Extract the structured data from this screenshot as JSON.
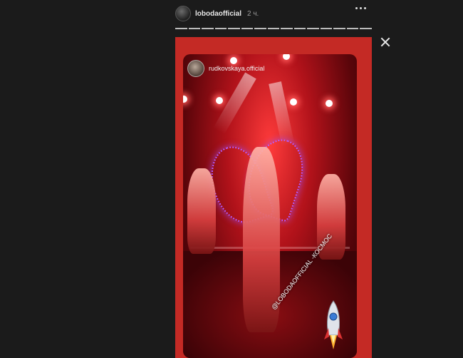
{
  "header": {
    "username": "lobodaofficial",
    "time_ago": "2 ч.",
    "avatar_icon": "profile-avatar-icon",
    "more_icon": "more-horizontal-icon"
  },
  "progress": {
    "segments": 15
  },
  "close_icon": "close-icon",
  "story": {
    "background_color": "#c42a25",
    "reposted_user": "rudkovskaya.official",
    "sticker_mention": "@LOBODAOFFICIAL -КОСМОС",
    "rocket_icon": "rocket-icon"
  }
}
